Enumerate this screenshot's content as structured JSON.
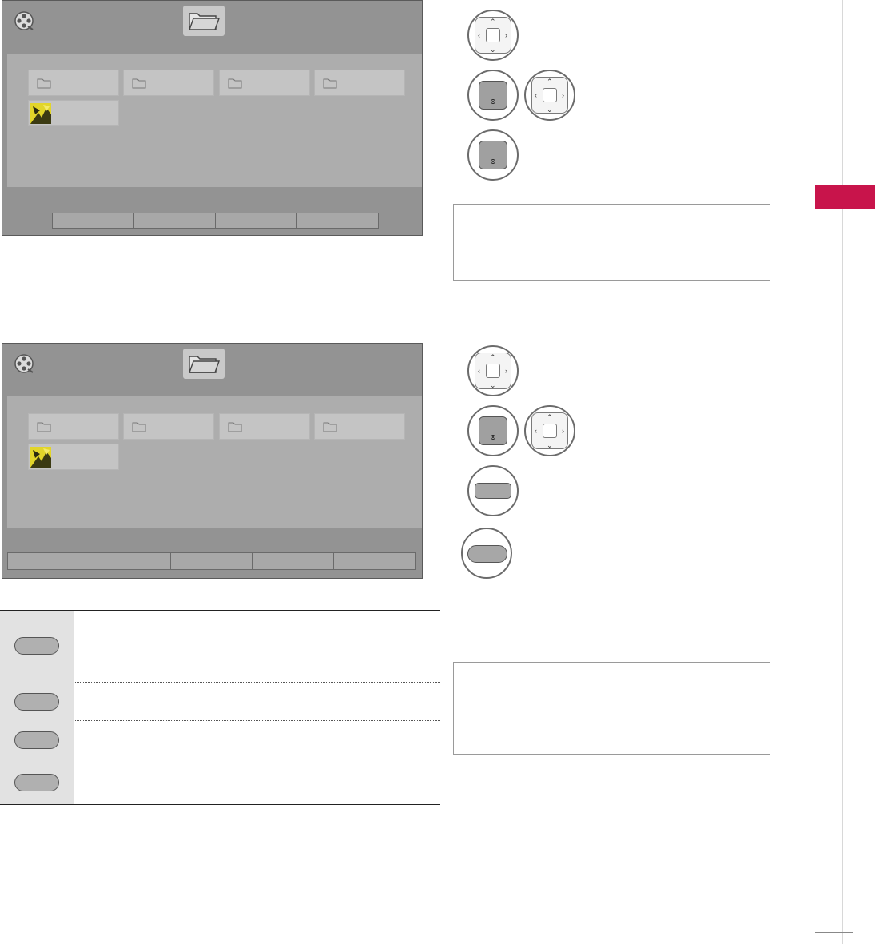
{
  "page": {
    "accent_color": "#c8144b",
    "side_tab": "",
    "page_number": ""
  },
  "screens": [
    {
      "name": "screen-1",
      "header_icon": "media-reel-icon",
      "folder_icon": "folder-open-icon",
      "items": [
        {
          "type": "folder",
          "label": ""
        },
        {
          "type": "folder",
          "label": ""
        },
        {
          "type": "folder",
          "label": ""
        },
        {
          "type": "folder",
          "label": ""
        },
        {
          "type": "photo",
          "label": ""
        }
      ],
      "buttons": [
        "",
        "",
        "",
        ""
      ]
    },
    {
      "name": "screen-2",
      "header_icon": "media-reel-icon",
      "folder_icon": "folder-open-icon",
      "items": [
        {
          "type": "folder",
          "label": ""
        },
        {
          "type": "folder",
          "label": ""
        },
        {
          "type": "folder",
          "label": ""
        },
        {
          "type": "folder",
          "label": ""
        },
        {
          "type": "photo",
          "label": ""
        }
      ],
      "buttons": [
        "",
        "",
        "",
        "",
        ""
      ]
    }
  ],
  "steps_1": [
    {
      "icon": "navigation-dpad-icon"
    },
    {
      "icon": "ok-button-icon"
    },
    {
      "icon": "ok-button-icon"
    }
  ],
  "steps_2": [
    {
      "icon": "navigation-dpad-icon"
    },
    {
      "icon": "ok-button-icon"
    },
    {
      "icon": "color-button-icon"
    },
    {
      "icon": "color-button-icon"
    }
  ],
  "notes": [
    "",
    ""
  ],
  "controls_table": [
    {
      "button_icon": "color-button-icon",
      "description": ""
    },
    {
      "button_icon": "color-button-icon",
      "description": ""
    },
    {
      "button_icon": "color-button-icon",
      "description": ""
    },
    {
      "button_icon": "color-button-icon",
      "description": ""
    }
  ]
}
